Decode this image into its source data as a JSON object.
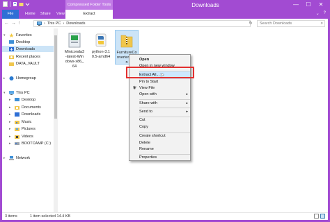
{
  "window": {
    "title": "Downloads",
    "context_group": "Compressed Folder Tools",
    "minimize": "—",
    "maximize": "☐",
    "close": "✕"
  },
  "ribbon": {
    "tabs": [
      "File",
      "Home",
      "Share",
      "View",
      "Extract"
    ],
    "expand": "⌄",
    "help": "?"
  },
  "address": {
    "back": "←",
    "forward": "→",
    "up": "↑",
    "crumbs": [
      "This PC",
      "Downloads"
    ],
    "separator": "›",
    "search_placeholder": "Search Downloads"
  },
  "navpane": {
    "favorites_header": "Favorites",
    "favorites": [
      "Desktop",
      "Downloads",
      "Recent places",
      "DATA_VAULT"
    ],
    "homegroup": "Homegroup",
    "thispc_header": "This PC",
    "thispc_items": [
      "Desktop",
      "Documents",
      "Downloads",
      "Music",
      "Pictures",
      "Videos",
      "BOOTCAMP (C:)"
    ],
    "network": "Network"
  },
  "files": [
    {
      "label_lines": [
        "Miniconda3",
        "-latest-Win",
        "dows-x86_",
        "64"
      ],
      "icon": "installer-icon"
    },
    {
      "label_lines": [
        "python-3.1",
        "0.5-amd64"
      ],
      "icon": "python-icon"
    },
    {
      "label_lines": [
        "FurnitureCo",
        "nverter_ma",
        "n"
      ],
      "icon": "zip-folder-icon"
    }
  ],
  "context_menu": {
    "open": "Open",
    "open_new_window": "Open in new window",
    "extract_all": "Extract All...",
    "pin_to_start": "Pin to Start",
    "view_file": "View File",
    "open_with": "Open with",
    "share_with": "Share with",
    "send_to": "Send to",
    "cut": "Cut",
    "copy": "Copy",
    "create_shortcut": "Create shortcut",
    "delete": "Delete",
    "rename": "Rename",
    "properties": "Properties",
    "submenu_arrow": "▸"
  },
  "status": {
    "items": "3 items",
    "selected": "1 item selected  14.4 KB"
  },
  "colors": {
    "title_bar": "#a24bd2",
    "file_tab": "#2e6fd5",
    "selection": "#cce4f7",
    "highlight_box": "#e3302f"
  }
}
